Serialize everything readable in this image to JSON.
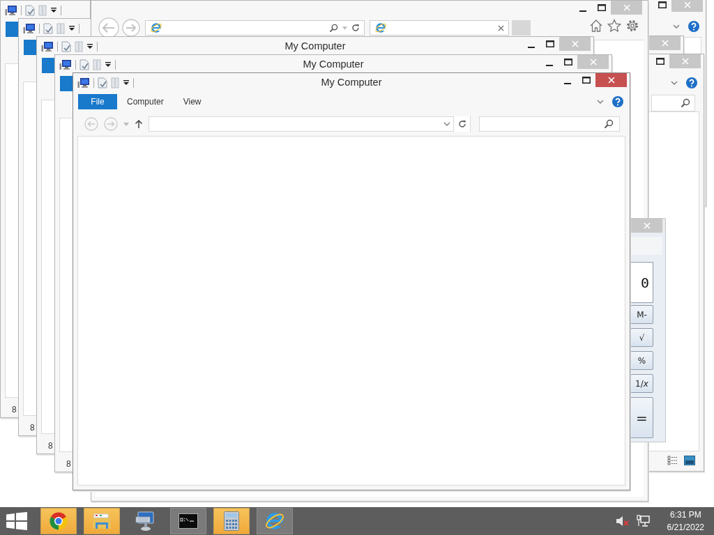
{
  "explorer_windows": [
    {
      "ribbon_tabs": [
        {
          "selected": true
        }
      ],
      "status_text": "8"
    },
    {
      "ribbon_tabs": [
        {
          "selected": true
        }
      ],
      "status_text": "8"
    },
    {
      "title": "My Computer",
      "active": false,
      "ribbon_tabs": [
        {
          "selected": true
        }
      ],
      "status_text": "8"
    },
    {
      "title": "My Computer",
      "active": false,
      "ribbon_tabs": [
        {
          "selected": true
        }
      ],
      "status_text": "8"
    },
    {
      "title": "My Computer",
      "active": true,
      "ribbon_tabs": [
        {
          "label": "File",
          "selected": true
        },
        {
          "label": "Computer",
          "selected": false
        },
        {
          "label": "View",
          "selected": false
        }
      ]
    }
  ],
  "browser_window": {
    "active": false
  },
  "calculator": {
    "display": "0",
    "buttons": [
      {
        "label": "M-",
        "kind": "small"
      },
      {
        "label": "√",
        "kind": "small"
      },
      {
        "label": "%",
        "kind": "small"
      },
      {
        "label": "1/*x*",
        "kind": "small"
      },
      {
        "label": "=",
        "kind": "tall"
      }
    ]
  },
  "taskbar": {
    "apps": [
      {
        "kind": "chrome",
        "highlighted": true,
        "running": true
      },
      {
        "kind": "file-explorer",
        "highlighted": true,
        "running": true
      },
      {
        "kind": "remote-desktop",
        "highlighted": false,
        "running": false
      },
      {
        "kind": "command-prompt",
        "highlighted": false,
        "running": true
      },
      {
        "kind": "calculator",
        "highlighted": true,
        "running": true
      },
      {
        "kind": "internet-explorer",
        "highlighted": false,
        "running": true
      }
    ],
    "volume_muted": true,
    "time": "6:31 PM",
    "date": "6/21/2022"
  }
}
